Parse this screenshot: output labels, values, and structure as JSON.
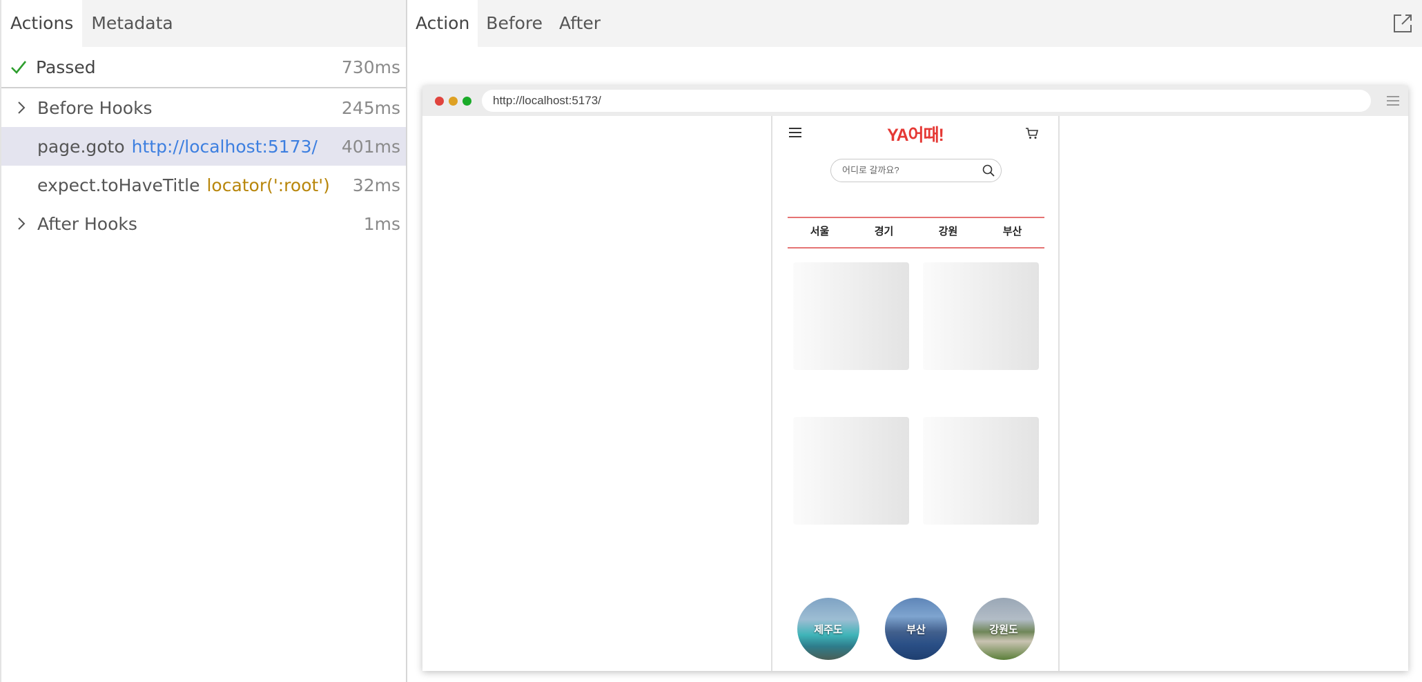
{
  "left_panel": {
    "tabs": [
      {
        "label": "Actions"
      },
      {
        "label": "Metadata"
      }
    ],
    "status": {
      "label": "Passed",
      "duration": "730ms",
      "color": "#2e9e2e"
    },
    "rows": [
      {
        "name": "Before Hooks",
        "param": "",
        "duration": "245ms"
      },
      {
        "name": "page.goto",
        "param": "http://localhost:5173/",
        "duration": "401ms"
      },
      {
        "name": "expect.toHaveTitle",
        "param": "locator(':root')",
        "duration": "32ms"
      },
      {
        "name": "After Hooks",
        "param": "",
        "duration": "1ms"
      }
    ]
  },
  "right_panel": {
    "tabs": [
      {
        "label": "Action"
      },
      {
        "label": "Before"
      },
      {
        "label": "After"
      }
    ]
  },
  "browser": {
    "url": "http://localhost:5173/",
    "dots": [
      "#e0443e",
      "#dea123",
      "#1aab29"
    ]
  },
  "app": {
    "logo": "YA어때!",
    "search_placeholder": "어디로 갈까요?",
    "regions": [
      "서울",
      "경기",
      "강원",
      "부산"
    ],
    "destinations": [
      "제주도",
      "부산",
      "강원도"
    ],
    "accent": "#e53935"
  }
}
